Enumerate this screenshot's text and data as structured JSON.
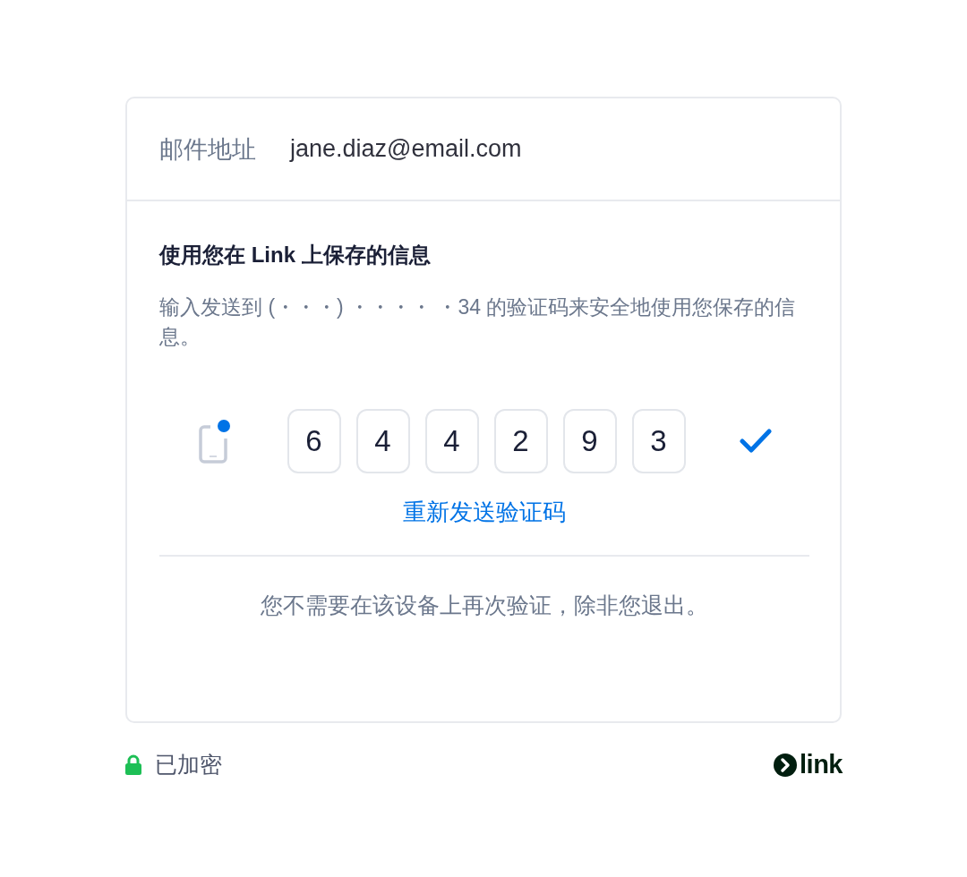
{
  "email_row": {
    "label": "邮件地址",
    "value": "jane.diaz@email.com"
  },
  "verification": {
    "title": "使用您在 Link 上保存的信息",
    "description": "输入发送到 (・・・) ・・・・ ・34 的验证码来安全地使用您保存的信息。",
    "code": [
      "6",
      "4",
      "4",
      "2",
      "9",
      "3"
    ],
    "verified": true,
    "resend_link": "重新发送验证码",
    "note": "您不需要在该设备上再次验证，除非您退出。"
  },
  "footer": {
    "security": "已加密",
    "brand": "link"
  }
}
